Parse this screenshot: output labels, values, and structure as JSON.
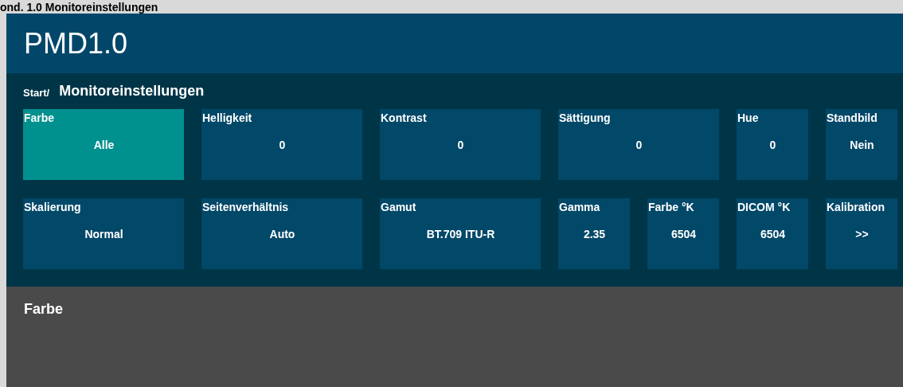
{
  "caption": "ond. 1.0 Monitoreinstellungen",
  "app": {
    "title": "PMD1.0"
  },
  "breadcrumb": {
    "root": "Start/",
    "current": "Monitoreinstellungen"
  },
  "tiles": [
    {
      "kind": "wide",
      "label": "Farbe",
      "value": "Alle",
      "selected": true
    },
    {
      "kind": "wide",
      "label": "Helligkeit",
      "value": "0",
      "selected": false
    },
    {
      "kind": "wide",
      "label": "Kontrast",
      "value": "0",
      "selected": false
    },
    {
      "kind": "wide",
      "label": "Sättigung",
      "value": "0",
      "selected": false
    },
    {
      "kind": "narrow",
      "label": "Hue",
      "value": "0",
      "selected": false
    },
    {
      "kind": "narrow",
      "label": "Standbild",
      "value": "Nein",
      "selected": false
    },
    {
      "kind": "wide",
      "label": "Skalierung",
      "value": "Normal",
      "selected": false
    },
    {
      "kind": "wide",
      "label": "Seitenverhältnis",
      "value": "Auto",
      "selected": false
    },
    {
      "kind": "wide",
      "label": "Gamut",
      "value": "BT.709 ITU-R",
      "selected": false
    },
    {
      "kind": "narrow",
      "label": "Gamma",
      "value": "2.35",
      "selected": false
    },
    {
      "kind": "narrow",
      "label": "Farbe °K",
      "value": "6504",
      "selected": false
    },
    {
      "kind": "narrow",
      "label": "DICOM °K",
      "value": "6504",
      "selected": false
    },
    {
      "kind": "narrow",
      "label": "Kalibration",
      "value": ">>",
      "selected": false
    }
  ],
  "detail": {
    "title": "Farbe"
  }
}
